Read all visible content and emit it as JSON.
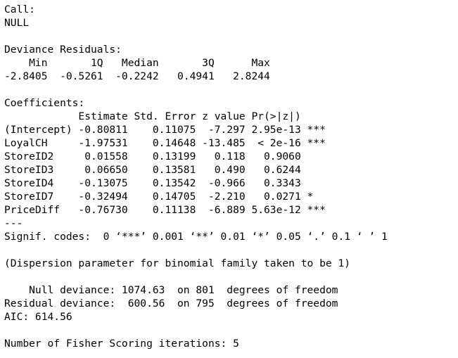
{
  "call_header": "Call:",
  "call_value": "NULL",
  "deviance_residuals": {
    "title": "Deviance Residuals:",
    "header": "    Min       1Q   Median       3Q      Max  ",
    "values": "-2.8405  -0.5261  -0.2242   0.4941   2.8244  "
  },
  "coefficients": {
    "title": "Coefficients:",
    "header": "            Estimate Std. Error z value Pr(>|z|)    ",
    "rows": [
      "(Intercept) -0.80811    0.11075  -7.297 2.95e-13 ***",
      "LoyalCH     -1.97531    0.14648 -13.485  < 2e-16 ***",
      "StoreID2     0.01558    0.13199   0.118   0.9060    ",
      "StoreID3     0.06650    0.13581   0.490   0.6244    ",
      "StoreID4    -0.13075    0.13542  -0.966   0.3343    ",
      "StoreID7    -0.32494    0.14705  -2.210   0.0271 *  ",
      "PriceDiff   -0.76730    0.11138  -6.889 5.63e-12 ***"
    ],
    "separator": "---",
    "signif_codes": "Signif. codes:  0 ‘***’ 0.001 ‘**’ 0.01 ‘*’ 0.05 ‘.’ 0.1 ‘ ’ 1"
  },
  "dispersion_note": "(Dispersion parameter for binomial family taken to be 1)",
  "deviance": {
    "null": "    Null deviance: 1074.63  on 801  degrees of freedom",
    "residual": "Residual deviance:  600.56  on 795  degrees of freedom"
  },
  "aic": "AIC: 614.56",
  "fisher_iterations": "Number of Fisher Scoring iterations: 5"
}
